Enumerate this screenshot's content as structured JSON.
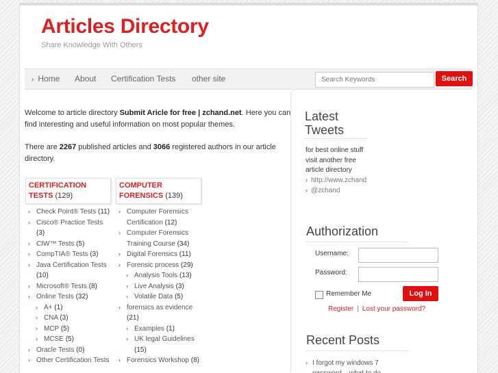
{
  "site": {
    "title": "Articles Directory",
    "tagline": "Share Knowledge With Others"
  },
  "nav": {
    "items": [
      "Home",
      "About",
      "Certification Tests",
      "other site"
    ],
    "search_placeholder": "Search Keywords",
    "search_button": "Search"
  },
  "intro": {
    "welcome_prefix": "Welcome to article directory ",
    "site_name": "Submit Aricle for free | zchand.net",
    "welcome_suffix": ". Here you can find interesting and useful information on most popular themes.",
    "stats_prefix": "There are ",
    "articles_count": "2267",
    "stats_mid": " published articles and ",
    "authors_count": "3066",
    "stats_suffix": " registered authors in our article directory."
  },
  "categories": {
    "certification": {
      "title": "CERTIFICATION TESTS",
      "count": "(129)",
      "items": [
        {
          "label": "Check Point® Tests",
          "count": "(11)",
          "sub": false
        },
        {
          "label": "Cisco® Practice Tests",
          "count": "(3)",
          "sub": false
        },
        {
          "label": "CIW™ Tests",
          "count": "(5)",
          "sub": false
        },
        {
          "label": "CompTIA® Tests",
          "count": "(3)",
          "sub": false
        },
        {
          "label": "Java Certification Tests",
          "count": "(10)",
          "sub": false
        },
        {
          "label": "Microsoft® Tests",
          "count": "(8)",
          "sub": false
        },
        {
          "label": "Online Tests",
          "count": "(32)",
          "sub": false
        },
        {
          "label": "A+",
          "count": "(1)",
          "sub": true
        },
        {
          "label": "CNA",
          "count": "(3)",
          "sub": true
        },
        {
          "label": "MCP",
          "count": "(5)",
          "sub": true
        },
        {
          "label": "MCSE",
          "count": "(5)",
          "sub": true
        },
        {
          "label": "Oracle Tests",
          "count": "(0)",
          "sub": false
        },
        {
          "label": "Other Certification Tests",
          "count": "",
          "sub": false
        }
      ]
    },
    "forensics": {
      "title": "COMPUTER FORENSICS",
      "count": "(139)",
      "items": [
        {
          "label": "Computer Forensics Certification",
          "count": "(12)",
          "sub": false
        },
        {
          "label": "Computer Forensics Training Course",
          "count": "(34)",
          "sub": false
        },
        {
          "label": "Digital Forensics",
          "count": "(11)",
          "sub": false
        },
        {
          "label": "Forensic process",
          "count": "(29)",
          "sub": false
        },
        {
          "label": "Analysis Tools",
          "count": "(13)",
          "sub": true
        },
        {
          "label": "Live Analysis",
          "count": "(3)",
          "sub": true
        },
        {
          "label": "Volatile Data",
          "count": "(5)",
          "sub": true
        },
        {
          "label": "forensics as evidence",
          "count": "(21)",
          "sub": false
        },
        {
          "label": "Examples",
          "count": "(1)",
          "sub": true
        },
        {
          "label": "UK legal Guidelines",
          "count": "(15)",
          "sub": true
        },
        {
          "label": "Forensics Workshop",
          "count": "(8)",
          "sub": false
        }
      ]
    }
  },
  "sidebar": {
    "tweets": {
      "heading": "Latest Tweets",
      "text": "for best online stuff visit another free article directory",
      "link1": "http://www.zchand",
      "link2": "@zchand"
    },
    "auth": {
      "heading": "Authorization",
      "username_label": "Username:",
      "password_label": "Password:",
      "remember_label": "Remember Me",
      "login_button": "Log In",
      "register_link": "Register",
      "lost_password_link": "Lost your password?"
    },
    "recent": {
      "heading": "Recent Posts",
      "post1": "I forgot my windows 7 password – what to do"
    }
  },
  "colors": {
    "accent": "#e21d1d",
    "button": "#e01010"
  }
}
